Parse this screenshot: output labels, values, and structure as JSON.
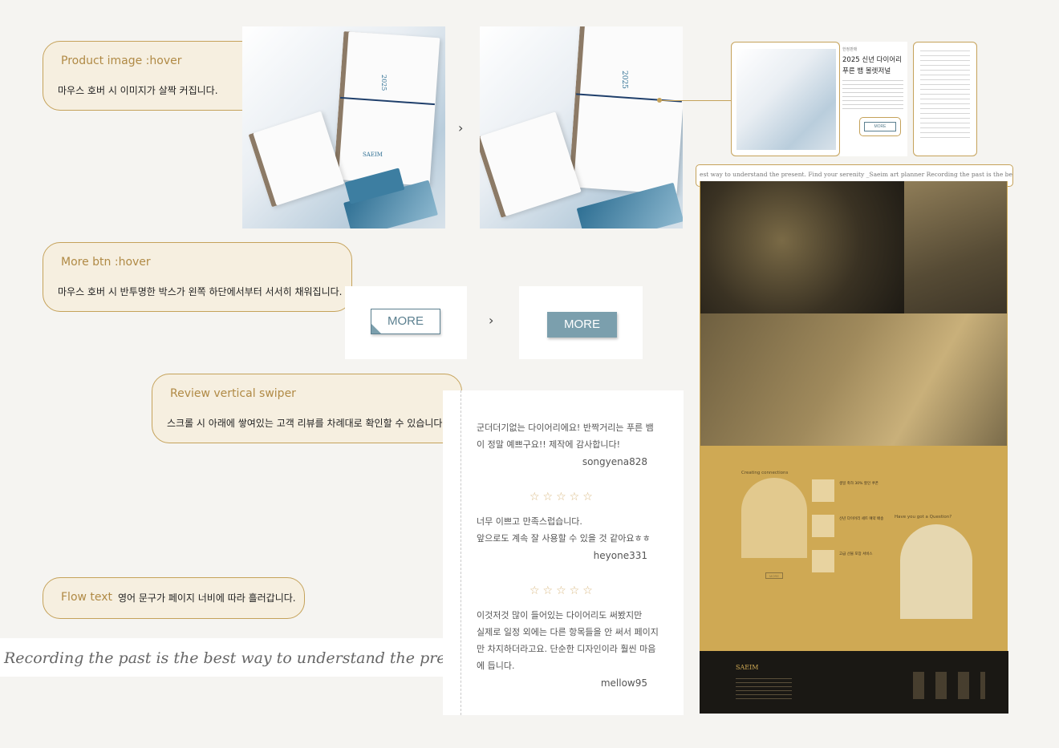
{
  "product_hover": {
    "title": "Product image :hover",
    "description": "마우스 호버 시 이미지가 살짝 커집니다.",
    "brand_mark": "SAEIM",
    "year_mark": "2025"
  },
  "more_hover": {
    "title": "More btn :hover",
    "description": "마우스 호버 시 반투명한 박스가 왼쪽 하단에서부터 서서히 채워집니다.",
    "btn_default_label": "MORE",
    "btn_hover_label": "MORE"
  },
  "review_swiper": {
    "title": "Review vertical swiper",
    "description": "스크롤 시 아래에 쌓여있는  고객 리뷰를 차례대로  확인할 수 있습니다.",
    "reviews": [
      {
        "lines": [
          "군더더기없는 다이어리에요! 반짝거리는 푸른 뱀",
          "이 정말 예쁘구요!! 제작에 감사합니다!"
        ],
        "user": "songyena828",
        "stars": ""
      },
      {
        "lines": [
          "너무 이쁘고 만족스럽습니다.",
          "앞으로도 계속 잘 사용할 수 있을 것 같아요ㅎㅎ"
        ],
        "user": "heyone331",
        "stars": "☆☆☆☆☆"
      },
      {
        "lines": [
          "이것저것 많이 들어있는 다이어리도 써봤지만",
          "실제로 일정 외에는 다른 항목들을 안 써서 페이지",
          "만 차지하더라고요. 단순한 디자인이라 훨씬 마음",
          "에 듭니다."
        ],
        "user": "mellow95",
        "stars": "☆☆☆☆☆"
      }
    ]
  },
  "flow_text": {
    "title": "Flow text",
    "description": "영어 문구가 페이지 너비에 따라 흘러갑니다.",
    "marquee": "Recording the past is the best way to understand the present. Fi"
  },
  "mock_site": {
    "product_card": {
      "eyebrow": "한정판매",
      "title_line1": "2025 신년 다이어리",
      "title_line2": "푸른 뱀 볼렛저널",
      "more_label": "MORE"
    },
    "marquee": "est way to understand the present. Find your serenity _Saeim art planner     Recording the past is the best way t",
    "section_label": "Creating connections",
    "question_label": "Have you got a Question?",
    "events": [
      "생일 축하 30% 할인 쿠폰",
      "신년 다이어리 세트 예약 배송",
      "고급 선물 포장 서비스"
    ],
    "event_more": "MORE",
    "footer_logo": "SAEIM"
  },
  "colors": {
    "accent_gold": "#c5a25a",
    "callout_bg": "#f6efe0",
    "btn_hover": "#7b9fad",
    "btn_border": "#5c8090",
    "mock_gold": "#cfa954",
    "footer_dark": "#1a1814"
  }
}
